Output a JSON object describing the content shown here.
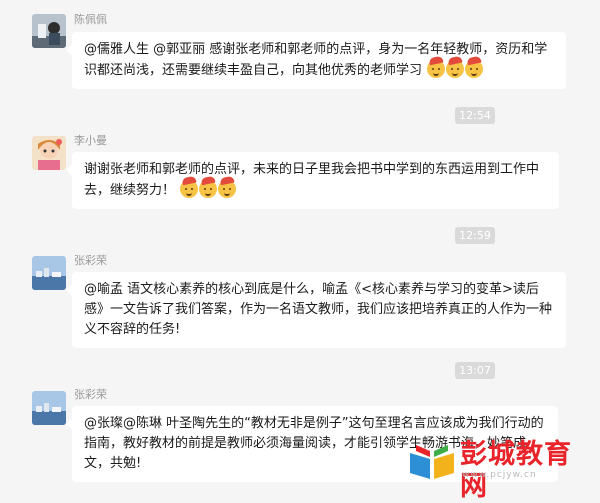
{
  "messages": [
    {
      "sender": "陈佩佩",
      "text": "@儒雅人生 @郭亚丽 感谢张老师和郭老师的点评，身为一名年轻教师，资历和学识都还尚浅，还需要继续丰盈自己，向其他优秀的老师学习",
      "emoji": [
        "party-face-icon",
        "party-face-icon",
        "party-face-icon"
      ]
    },
    {
      "time": "12:54"
    },
    {
      "sender": "李小曼",
      "text": "谢谢张老师和郭老师的点评，未来的日子里我会把书中学到的东西运用到工作中去，继续努力！",
      "emoji": [
        "party-face-icon",
        "party-face-icon",
        "party-face-icon"
      ]
    },
    {
      "time": "12:59"
    },
    {
      "sender": "张彩荣",
      "text": "@喻孟 语文核心素养的核心到底是什么，喻孟《<核心素养与学习的变革>读后感》一文告诉了我们答案，作为一名语文教师，我们应该把培养真正的人作为一种义不容辞的任务!"
    },
    {
      "time": "13:07"
    },
    {
      "sender": "张彩荣",
      "text": "@张璨@陈琳   叶圣陶先生的“教材无非是例子”这句至理名言应该成为我们行动的指南，教好教材的前提是教师必须海量阅读，才能引领学生畅游书海，妙笔成文，共勉!"
    }
  ],
  "watermark": {
    "name": "彭城教育网",
    "url": "www.pcjyw.cn"
  }
}
